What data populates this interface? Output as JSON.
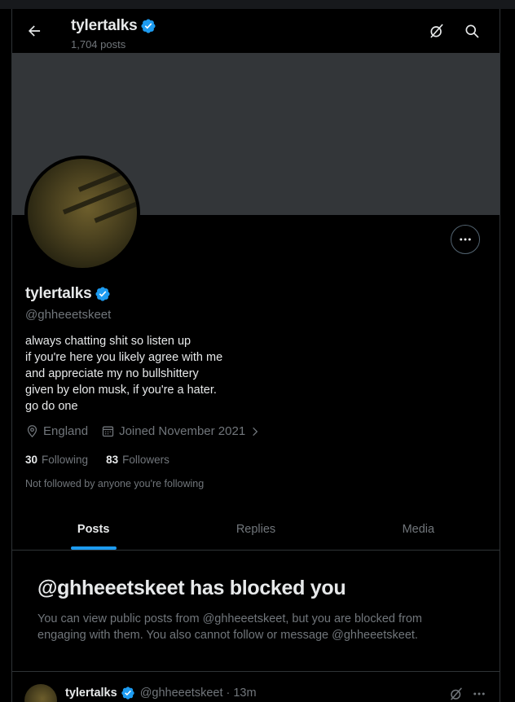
{
  "header": {
    "title": "tylertalks",
    "posts_count": "1,704 posts"
  },
  "profile": {
    "name": "tylertalks",
    "handle": "@ghheeetskeet",
    "bio_lines": [
      "always chatting shit so listen up",
      "if you're here you likely agree with me",
      "and appreciate my no bullshittery",
      "given by elon musk, if you're a hater.",
      "go do one"
    ],
    "location": "England",
    "joined": "Joined November 2021",
    "following_count": "30",
    "following_label": "Following",
    "followers_count": "83",
    "followers_label": "Followers",
    "not_followed_text": "Not followed by anyone you're following"
  },
  "tabs": [
    {
      "label": "Posts",
      "active": true
    },
    {
      "label": "Replies",
      "active": false
    },
    {
      "label": "Media",
      "active": false
    }
  ],
  "blocked": {
    "title": "@ghheeetskeet has blocked you",
    "description": "You can view public posts from @ghheeetskeet, but you are blocked from engaging with them. You also cannot follow or message @ghheeetskeet."
  },
  "post": {
    "name": "tylertalks",
    "handle": "@ghheeetskeet",
    "time": "· 13m"
  },
  "colors": {
    "accent": "#1d9bf0",
    "background": "#000000",
    "banner": "#333639",
    "muted_text": "#71767b"
  },
  "icons": {
    "back": "back-arrow-icon",
    "grok": "grok-icon",
    "search": "search-icon",
    "verified": "verified-badge-icon",
    "more": "more-icon",
    "location": "location-icon",
    "calendar": "calendar-icon",
    "chevron": "chevron-right-icon"
  }
}
